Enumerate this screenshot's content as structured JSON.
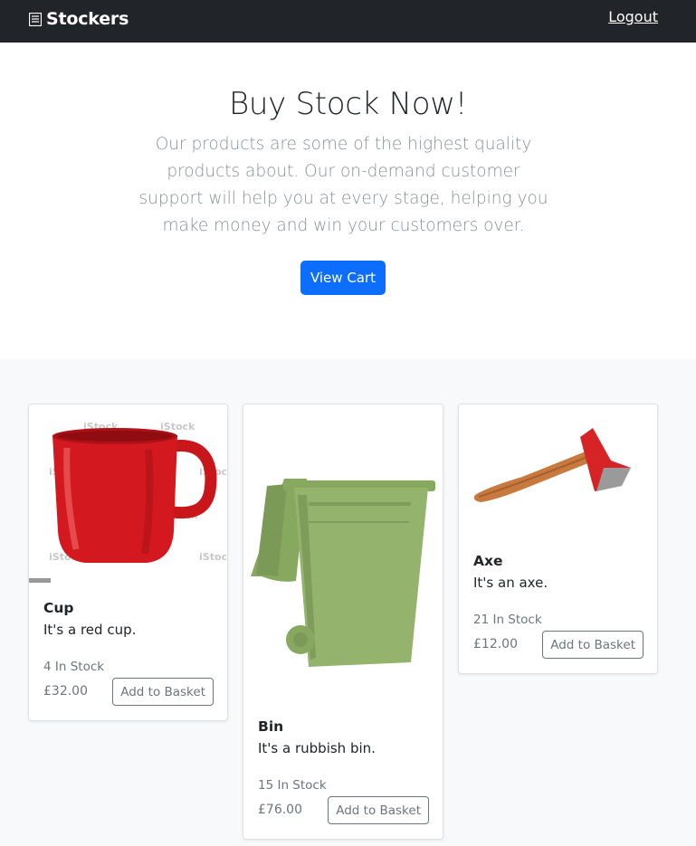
{
  "navbar": {
    "brand": "Stockers",
    "brand_icon": "document-icon",
    "logout": "Logout"
  },
  "hero": {
    "title": "Buy Stock Now!",
    "description": "Our products are some of the highest quality products about. Our on-demand customer support will help you at every stage, helping you make money and win your customers over.",
    "cta": "View Cart",
    "cta_color": "#0d6efd"
  },
  "products": [
    {
      "name": "Cup",
      "description": "It's a red cup.",
      "stock": "4 In Stock",
      "price": "£32.00",
      "button": "Add to Basket",
      "image": "red-cup-image",
      "watermark": "iStock"
    },
    {
      "name": "Bin",
      "description": "It's a rubbish bin.",
      "stock": "15 In Stock",
      "price": "£76.00",
      "button": "Add to Basket",
      "image": "green-wheelie-bin-image"
    },
    {
      "name": "Axe",
      "description": "It's an axe.",
      "stock": "21 In Stock",
      "price": "£12.00",
      "button": "Add to Basket",
      "image": "axe-image"
    }
  ]
}
